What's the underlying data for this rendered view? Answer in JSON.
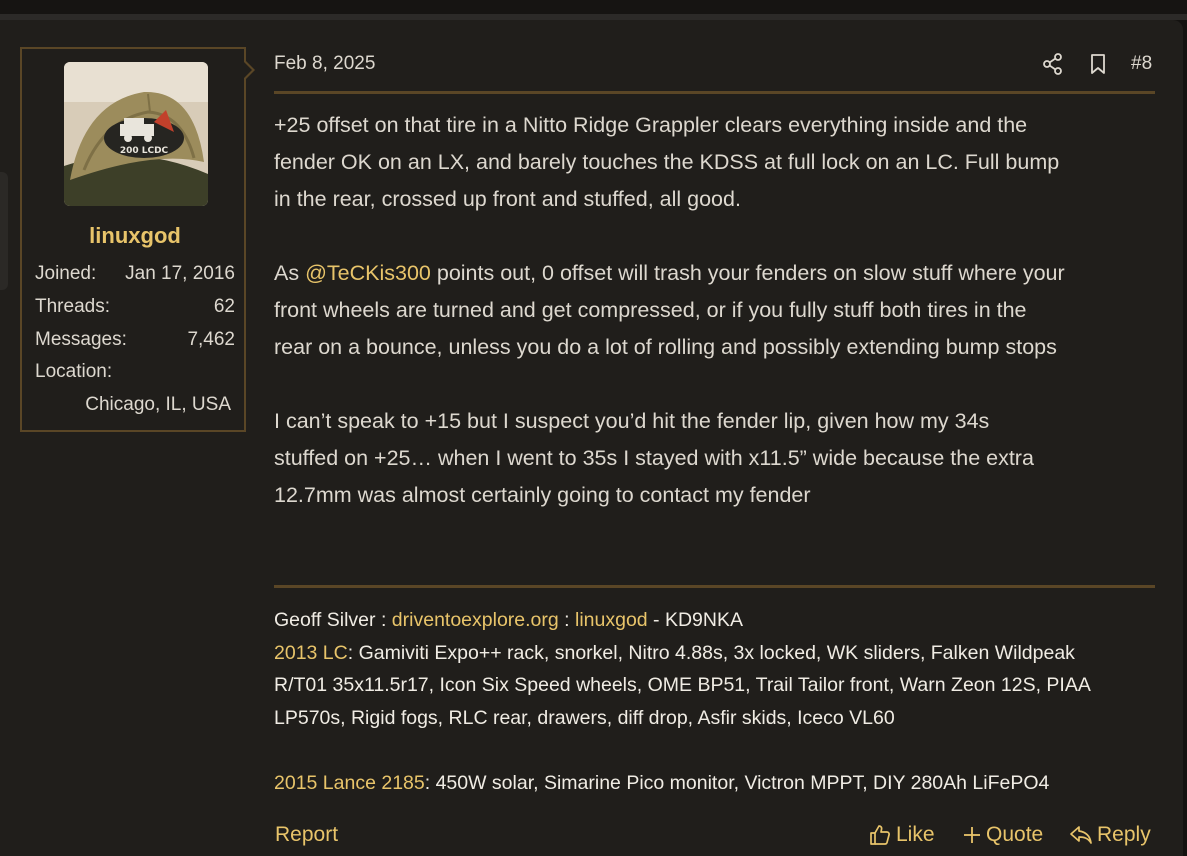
{
  "post": {
    "date": "Feb 8, 2025",
    "number": "#8",
    "header_icons": [
      "share-icon",
      "bookmark-icon"
    ]
  },
  "user": {
    "name": "linuxgod",
    "avatar_badge": "200 LCDC",
    "stats": {
      "joined_label": "Joined:",
      "joined_value": "Jan 17, 2016",
      "threads_label": "Threads:",
      "threads_value": "62",
      "messages_label": "Messages:",
      "messages_value": "7,462",
      "location_label": "Location:",
      "location_value": "Chicago, IL, USA"
    }
  },
  "body": {
    "p1_line1": "+25 offset on that tire in a Nitto Ridge Grappler clears everything inside and the",
    "p1_line2": "fender OK on an LX, and barely touches the KDSS at full lock on an LC. Full bump",
    "p1_line3": "in the rear, crossed up front and stuffed, all good.",
    "p2_prefix": "As ",
    "p2_mention": "@TeCKis300",
    "p2_line1_rest": " points out, 0 offset will trash your fenders on slow stuff where your",
    "p2_line2": "front wheels are turned and get compressed, or if you fully stuff both tires in the",
    "p2_line3": "rear on a bounce, unless you do a lot of rolling and possibly extending bump stops",
    "p3_line1": "I can’t speak to +15 but I suspect you’d hit the fender lip, given how my 34s",
    "p3_line2": "stuffed on +25… when I went to 35s I stayed with x11.5” wide because the extra",
    "p3_line3": "12.7mm was almost certainly going to contact my fender"
  },
  "signature": {
    "name": "Geoff Silver",
    "sep": " : ",
    "link_site": "driventoexplore.org",
    "link_user": "linuxgod",
    "callsign": " - KD9NKA",
    "lc_link": "2013 LC",
    "lc_line1": ": Gamiviti Expo++ rack, snorkel, Nitro 4.88s, 3x locked, WK sliders, Falken Wildpeak",
    "lc_line2": "R/T01 35x11.5r17, Icon Six Speed wheels, OME BP51, Trail Tailor front, Warn Zeon 12S, PIAA",
    "lc_line3": "LP570s, Rigid fogs, RLC rear, drawers, diff drop, Asfir skids, Iceco VL60",
    "lance_link": "2015 Lance 2185",
    "lance_text": ": 450W solar, Simarine Pico monitor, Victron MPPT, DIY 280Ah LiFePO4"
  },
  "actions": {
    "report": "Report",
    "like": "Like",
    "quote": "Quote",
    "reply": "Reply"
  },
  "colors": {
    "background": "#201e1b",
    "accent": "#e8c46a",
    "border": "#5a4626",
    "text": "#ddd8cf"
  }
}
